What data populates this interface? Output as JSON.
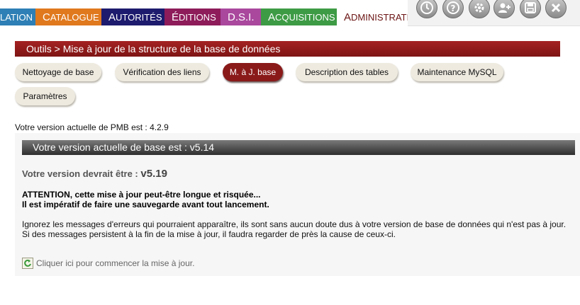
{
  "tabs": [
    {
      "label": "Circulation",
      "shown_first": "",
      "shown_rest": "LATION",
      "color": "#2d7fb5"
    },
    {
      "label": "Catalogue",
      "shown_first": "C",
      "shown_rest": "ATALOGUE",
      "color": "#e0791e"
    },
    {
      "label": "Autorités",
      "shown_first": "A",
      "shown_rest": "UTORITÉS",
      "color": "#1d1b6e"
    },
    {
      "label": "Éditions",
      "shown_first": "É",
      "shown_rest": "DITIONS",
      "color": "#8e1c5a"
    },
    {
      "label": "D.S.I.",
      "shown_first": "D",
      "shown_rest": ".S.I.",
      "color": "#a9489d"
    },
    {
      "label": "Acquisitions",
      "shown_first": "A",
      "shown_rest": "CQUISITIONS",
      "color": "#3d9b45"
    },
    {
      "label": "Administration",
      "shown_first": "A",
      "shown_rest": "DMINISTRATION",
      "color": "#ffffff"
    }
  ],
  "toolbar": [
    "clock-icon",
    "help-icon",
    "settings-icon",
    "user-icon",
    "save-icon",
    "close-icon"
  ],
  "breadcrumb": "Outils > Mise à jour de la structure de la base de données",
  "subnav": [
    "Nettoyage de base",
    "Vérification des liens",
    "M. à J. base",
    "Description des tables",
    "Maintenance MySQL",
    "Paramètres"
  ],
  "active_subnav": "M. à J. base",
  "pmb_version": "Votre version actuelle de PMB est : 4.2.9",
  "panel": {
    "header": "Votre version actuelle de base est : v5.14",
    "should_label": "Votre version devrait être :",
    "should_value": "v5.19",
    "warning_line1": "ATTENTION, cette mise à jour peut-être longue et risquée...",
    "warning_line2": "Il est impératif de faire une sauvegarde avant tout lancement.",
    "info_line1": "Ignorez les messages d'erreurs qui pourraient apparaître, ils sont sans aucun doute dus à votre version de base de données qui n'est pas à jour.",
    "info_line2": "Si des messages persistent à la fin de la mise à jour, il faudra regarder de près la cause de ceux-ci.",
    "launch_link": "Cliquer ici pour commencer la mise à jour."
  }
}
